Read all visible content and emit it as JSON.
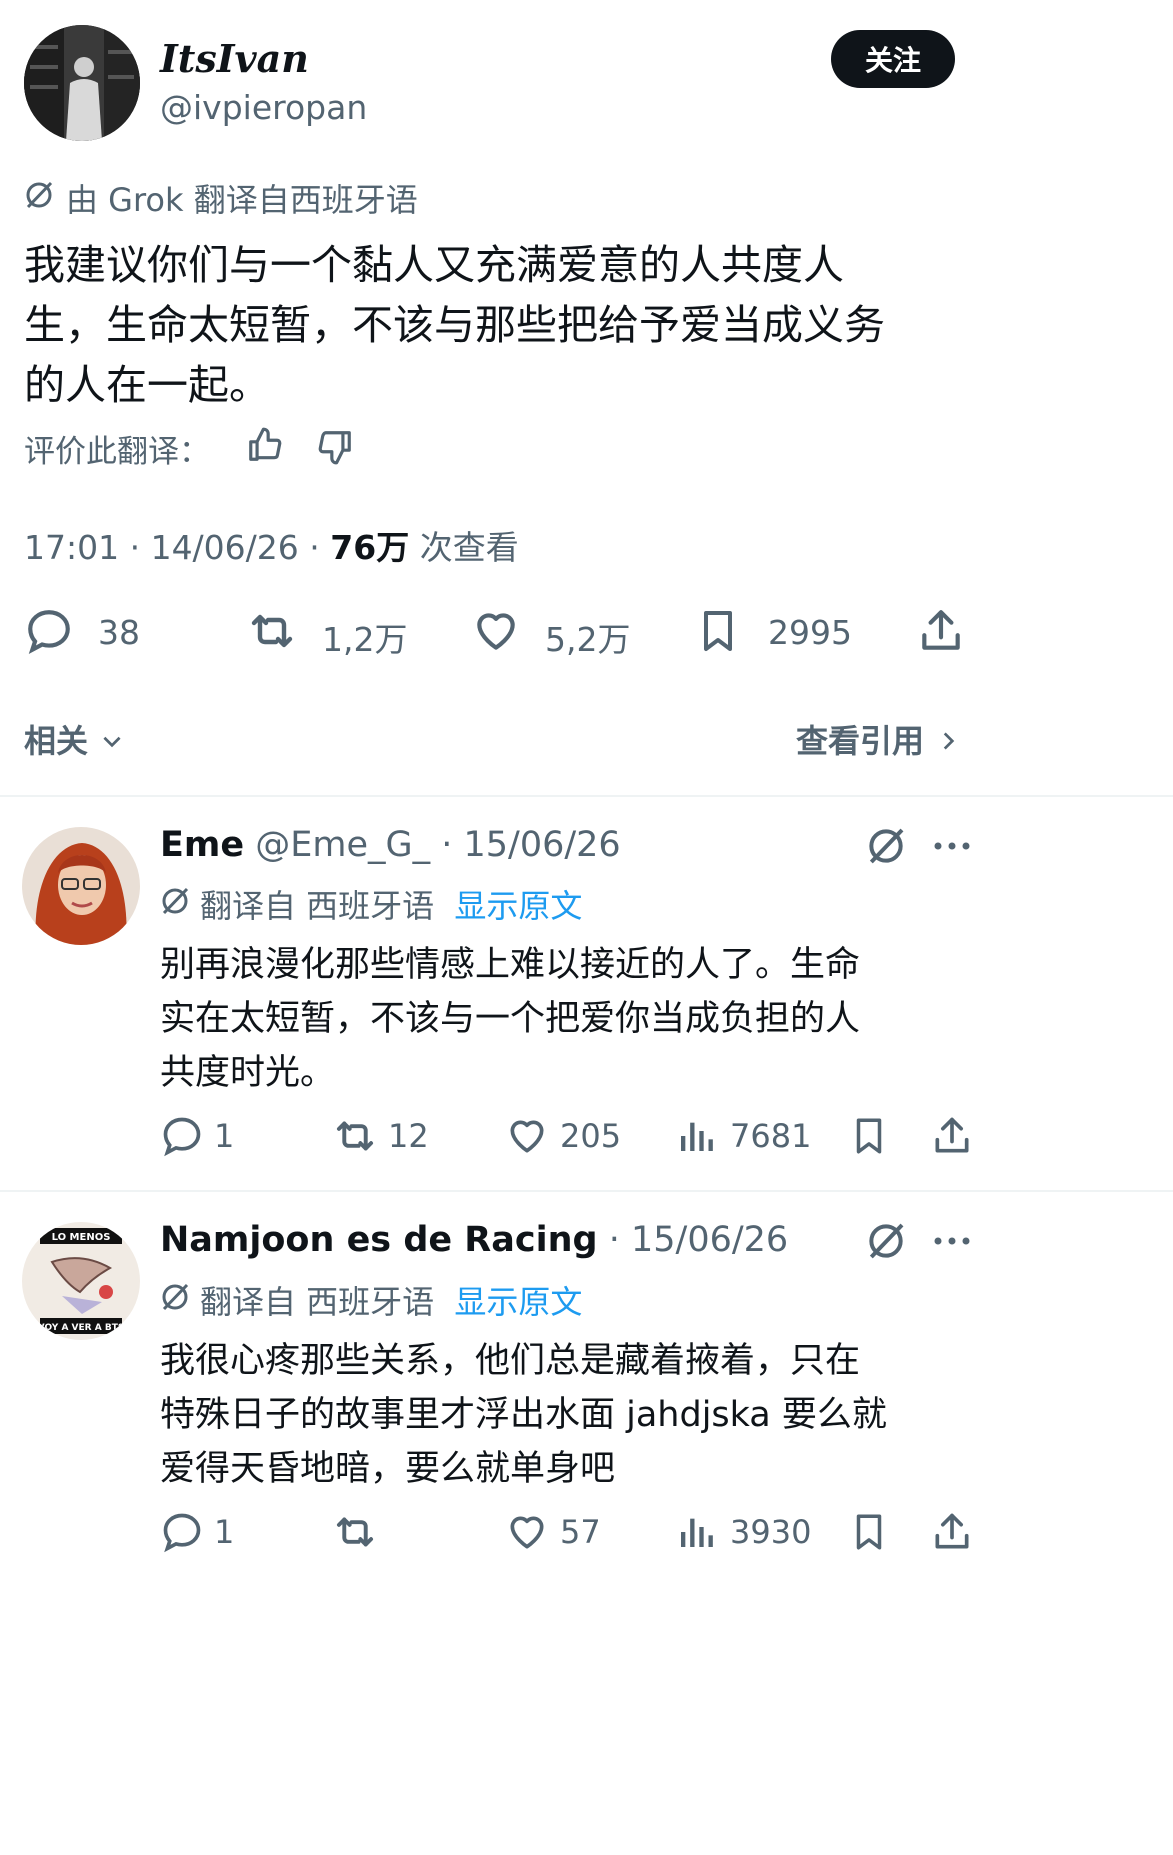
{
  "main_tweet": {
    "display_name": "ItsIvan",
    "handle": "@ivpieropan",
    "follow_label": "关注",
    "translated_by": "由 Grok 翻译自西班牙语",
    "text_lines": [
      "我建议你们与一个黏人又充满爱意的人共度人",
      "生，生命太短暂，不该与那些把给予爱当成义务",
      "的人在一起。"
    ],
    "rate_translation": "评价此翻译：",
    "timestamp": "17:01 · 14/06/26 ·",
    "views_count": "76万",
    "views_label": "次查看",
    "stats": {
      "replies": "38",
      "retweets": "1,2万",
      "likes": "5,2万",
      "bookmarks": "2995"
    }
  },
  "related": {
    "label": "相关",
    "quotes_label": "查看引用"
  },
  "replies": [
    {
      "display_name": "Eme",
      "handle_date": "@Eme_G_ · 15/06/26",
      "translated_from": "翻译自 西班牙语",
      "show_original": "显示原文",
      "text_lines": [
        "别再浪漫化那些情感上难以接近的人了。生命",
        "实在太短暂，不该与一个把爱你当成负担的人",
        "共度时光。"
      ],
      "stats": {
        "replies": "1",
        "retweets": "12",
        "likes": "205",
        "views": "7681"
      }
    },
    {
      "display_name": "Namjoon es de Racing",
      "handle_date": "· 15/06/26",
      "translated_from": "翻译自 西班牙语",
      "show_original": "显示原文",
      "avatar_text_top": "LO MENOS",
      "avatar_text_bottom": "VOY A VER A BTS",
      "text_lines": [
        "我很心疼那些关系，他们总是藏着掖着，只在",
        "特殊日子的故事里才浮出水面 jahdjska 要么就",
        "爱得天昏地暗，要么就单身吧"
      ],
      "stats": {
        "replies": "1",
        "retweets": "",
        "likes": "57",
        "views": "3930"
      }
    }
  ],
  "colors": {
    "accent": "#1d9bf0",
    "text": "#0f1419",
    "secondary": "#536471"
  }
}
